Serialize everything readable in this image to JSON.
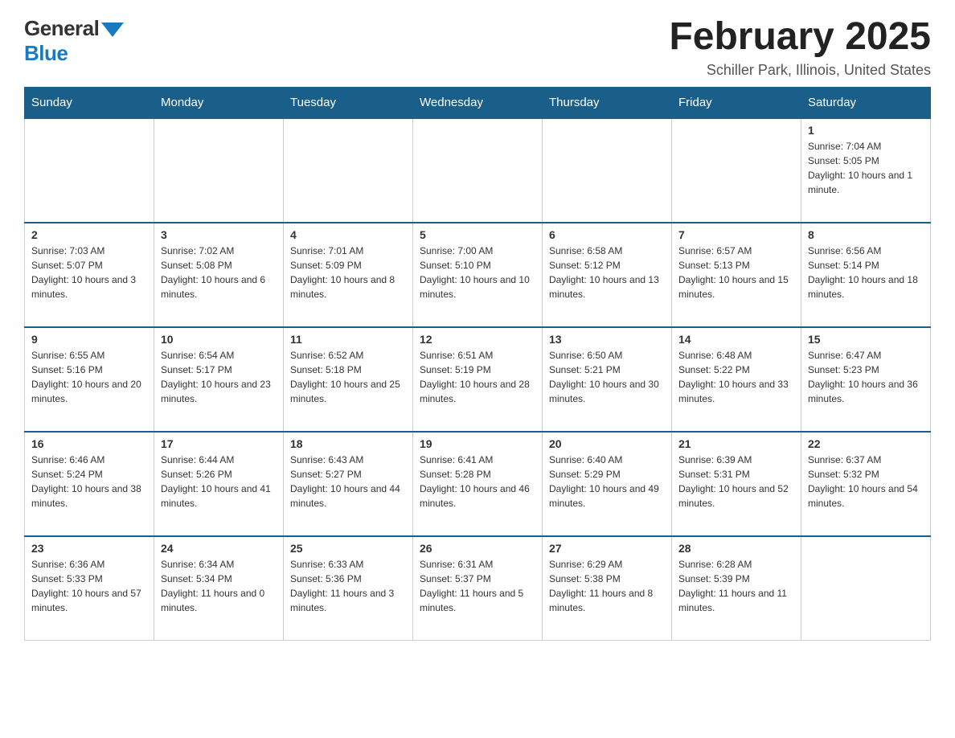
{
  "header": {
    "logo": {
      "general": "General",
      "blue": "Blue"
    },
    "title": "February 2025",
    "subtitle": "Schiller Park, Illinois, United States"
  },
  "calendar": {
    "days_of_week": [
      "Sunday",
      "Monday",
      "Tuesday",
      "Wednesday",
      "Thursday",
      "Friday",
      "Saturday"
    ],
    "weeks": [
      [
        {
          "day": "",
          "info": ""
        },
        {
          "day": "",
          "info": ""
        },
        {
          "day": "",
          "info": ""
        },
        {
          "day": "",
          "info": ""
        },
        {
          "day": "",
          "info": ""
        },
        {
          "day": "",
          "info": ""
        },
        {
          "day": "1",
          "info": "Sunrise: 7:04 AM\nSunset: 5:05 PM\nDaylight: 10 hours and 1 minute."
        }
      ],
      [
        {
          "day": "2",
          "info": "Sunrise: 7:03 AM\nSunset: 5:07 PM\nDaylight: 10 hours and 3 minutes."
        },
        {
          "day": "3",
          "info": "Sunrise: 7:02 AM\nSunset: 5:08 PM\nDaylight: 10 hours and 6 minutes."
        },
        {
          "day": "4",
          "info": "Sunrise: 7:01 AM\nSunset: 5:09 PM\nDaylight: 10 hours and 8 minutes."
        },
        {
          "day": "5",
          "info": "Sunrise: 7:00 AM\nSunset: 5:10 PM\nDaylight: 10 hours and 10 minutes."
        },
        {
          "day": "6",
          "info": "Sunrise: 6:58 AM\nSunset: 5:12 PM\nDaylight: 10 hours and 13 minutes."
        },
        {
          "day": "7",
          "info": "Sunrise: 6:57 AM\nSunset: 5:13 PM\nDaylight: 10 hours and 15 minutes."
        },
        {
          "day": "8",
          "info": "Sunrise: 6:56 AM\nSunset: 5:14 PM\nDaylight: 10 hours and 18 minutes."
        }
      ],
      [
        {
          "day": "9",
          "info": "Sunrise: 6:55 AM\nSunset: 5:16 PM\nDaylight: 10 hours and 20 minutes."
        },
        {
          "day": "10",
          "info": "Sunrise: 6:54 AM\nSunset: 5:17 PM\nDaylight: 10 hours and 23 minutes."
        },
        {
          "day": "11",
          "info": "Sunrise: 6:52 AM\nSunset: 5:18 PM\nDaylight: 10 hours and 25 minutes."
        },
        {
          "day": "12",
          "info": "Sunrise: 6:51 AM\nSunset: 5:19 PM\nDaylight: 10 hours and 28 minutes."
        },
        {
          "day": "13",
          "info": "Sunrise: 6:50 AM\nSunset: 5:21 PM\nDaylight: 10 hours and 30 minutes."
        },
        {
          "day": "14",
          "info": "Sunrise: 6:48 AM\nSunset: 5:22 PM\nDaylight: 10 hours and 33 minutes."
        },
        {
          "day": "15",
          "info": "Sunrise: 6:47 AM\nSunset: 5:23 PM\nDaylight: 10 hours and 36 minutes."
        }
      ],
      [
        {
          "day": "16",
          "info": "Sunrise: 6:46 AM\nSunset: 5:24 PM\nDaylight: 10 hours and 38 minutes."
        },
        {
          "day": "17",
          "info": "Sunrise: 6:44 AM\nSunset: 5:26 PM\nDaylight: 10 hours and 41 minutes."
        },
        {
          "day": "18",
          "info": "Sunrise: 6:43 AM\nSunset: 5:27 PM\nDaylight: 10 hours and 44 minutes."
        },
        {
          "day": "19",
          "info": "Sunrise: 6:41 AM\nSunset: 5:28 PM\nDaylight: 10 hours and 46 minutes."
        },
        {
          "day": "20",
          "info": "Sunrise: 6:40 AM\nSunset: 5:29 PM\nDaylight: 10 hours and 49 minutes."
        },
        {
          "day": "21",
          "info": "Sunrise: 6:39 AM\nSunset: 5:31 PM\nDaylight: 10 hours and 52 minutes."
        },
        {
          "day": "22",
          "info": "Sunrise: 6:37 AM\nSunset: 5:32 PM\nDaylight: 10 hours and 54 minutes."
        }
      ],
      [
        {
          "day": "23",
          "info": "Sunrise: 6:36 AM\nSunset: 5:33 PM\nDaylight: 10 hours and 57 minutes."
        },
        {
          "day": "24",
          "info": "Sunrise: 6:34 AM\nSunset: 5:34 PM\nDaylight: 11 hours and 0 minutes."
        },
        {
          "day": "25",
          "info": "Sunrise: 6:33 AM\nSunset: 5:36 PM\nDaylight: 11 hours and 3 minutes."
        },
        {
          "day": "26",
          "info": "Sunrise: 6:31 AM\nSunset: 5:37 PM\nDaylight: 11 hours and 5 minutes."
        },
        {
          "day": "27",
          "info": "Sunrise: 6:29 AM\nSunset: 5:38 PM\nDaylight: 11 hours and 8 minutes."
        },
        {
          "day": "28",
          "info": "Sunrise: 6:28 AM\nSunset: 5:39 PM\nDaylight: 11 hours and 11 minutes."
        },
        {
          "day": "",
          "info": ""
        }
      ]
    ]
  }
}
